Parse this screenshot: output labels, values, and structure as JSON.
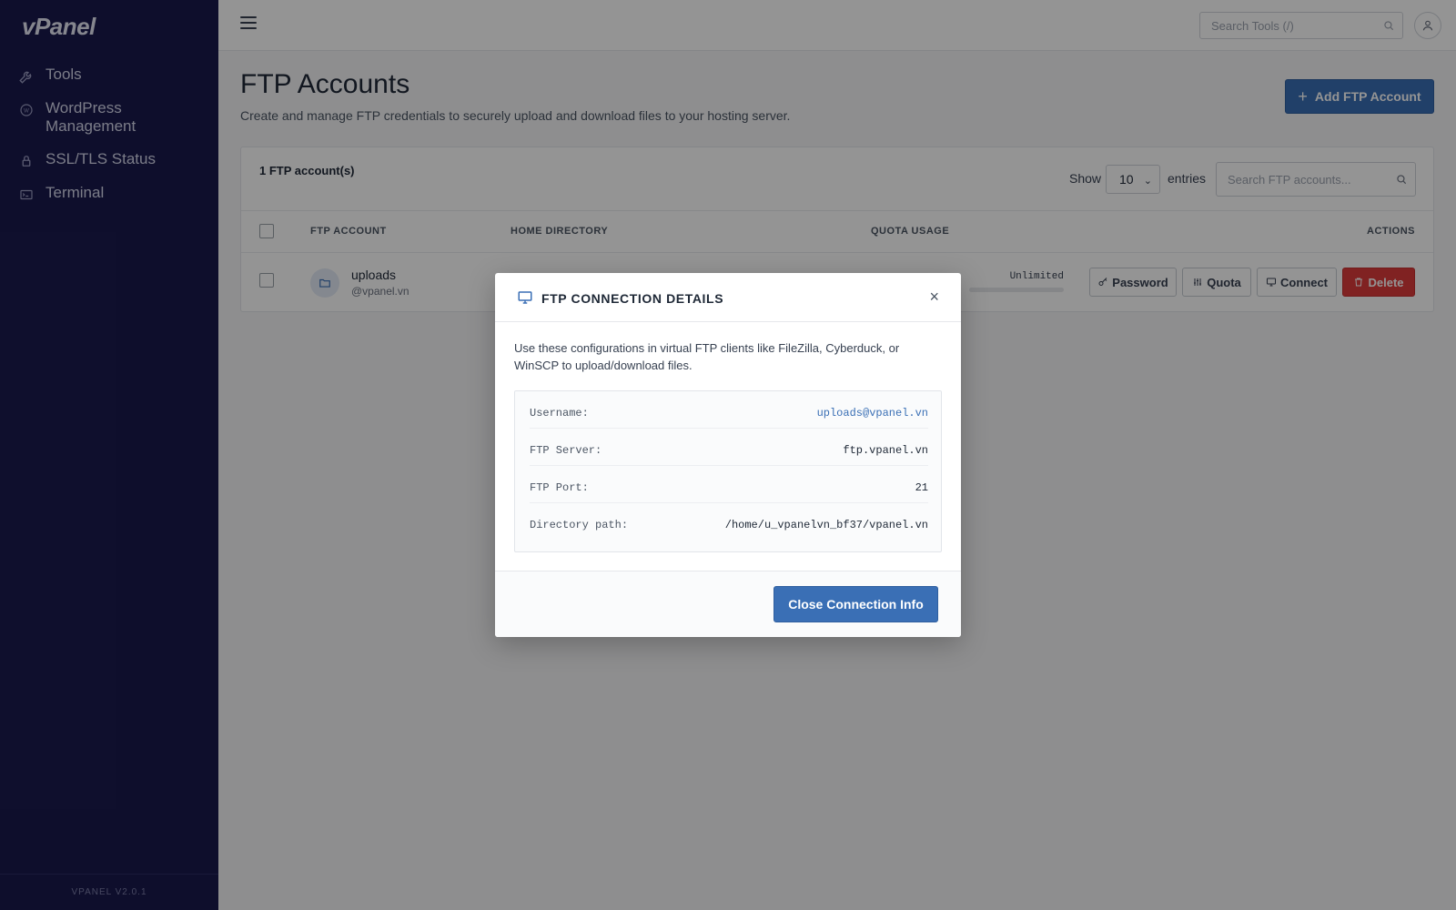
{
  "sidebar": {
    "logo": "vPanel",
    "items": [
      {
        "label": "Tools",
        "icon": "wrench-icon"
      },
      {
        "label": "WordPress Management",
        "icon": "wordpress-icon"
      },
      {
        "label": "SSL/TLS Status",
        "icon": "lock-icon"
      },
      {
        "label": "Terminal",
        "icon": "terminal-icon"
      }
    ],
    "version": "VPANEL V2.0.1"
  },
  "topbar": {
    "search_placeholder": "Search Tools (/)"
  },
  "page": {
    "title": "FTP Accounts",
    "description": "Create and manage FTP credentials to securely upload and download files to your hosting server.",
    "add_button": "Add FTP Account"
  },
  "table": {
    "count_label": "1 FTP account(s)",
    "show_label": "Show",
    "entries_value": "10",
    "entries_label": "entries",
    "search_placeholder": "Search FTP accounts...",
    "headers": {
      "account": "FTP ACCOUNT",
      "home": "HOME DIRECTORY",
      "quota": "QUOTA USAGE",
      "actions": "ACTIONS"
    },
    "rows": [
      {
        "name": "uploads",
        "domain": "@vpanel.vn",
        "quota": "Unlimited",
        "actions": {
          "password": "Password",
          "quota": "Quota",
          "connect": "Connect",
          "delete": "Delete"
        }
      }
    ]
  },
  "modal": {
    "title": "FTP CONNECTION DETAILS",
    "close_symbol": "×",
    "description": "Use these configurations in virtual FTP clients like FileZilla, Cyberduck, or WinSCP to upload/download files.",
    "details": [
      {
        "key": "Username:",
        "value": "uploads@vpanel.vn"
      },
      {
        "key": "FTP Server:",
        "value": "ftp.vpanel.vn"
      },
      {
        "key": "FTP Port:",
        "value": "21"
      },
      {
        "key": "Directory path:",
        "value": "/home/u_vpanelvn_bf37/vpanel.vn"
      }
    ],
    "close_button": "Close Connection Info"
  },
  "colors": {
    "sidebar_bg": "#19194d",
    "accent": "#3a6fb5",
    "danger": "#dc3c3c"
  }
}
